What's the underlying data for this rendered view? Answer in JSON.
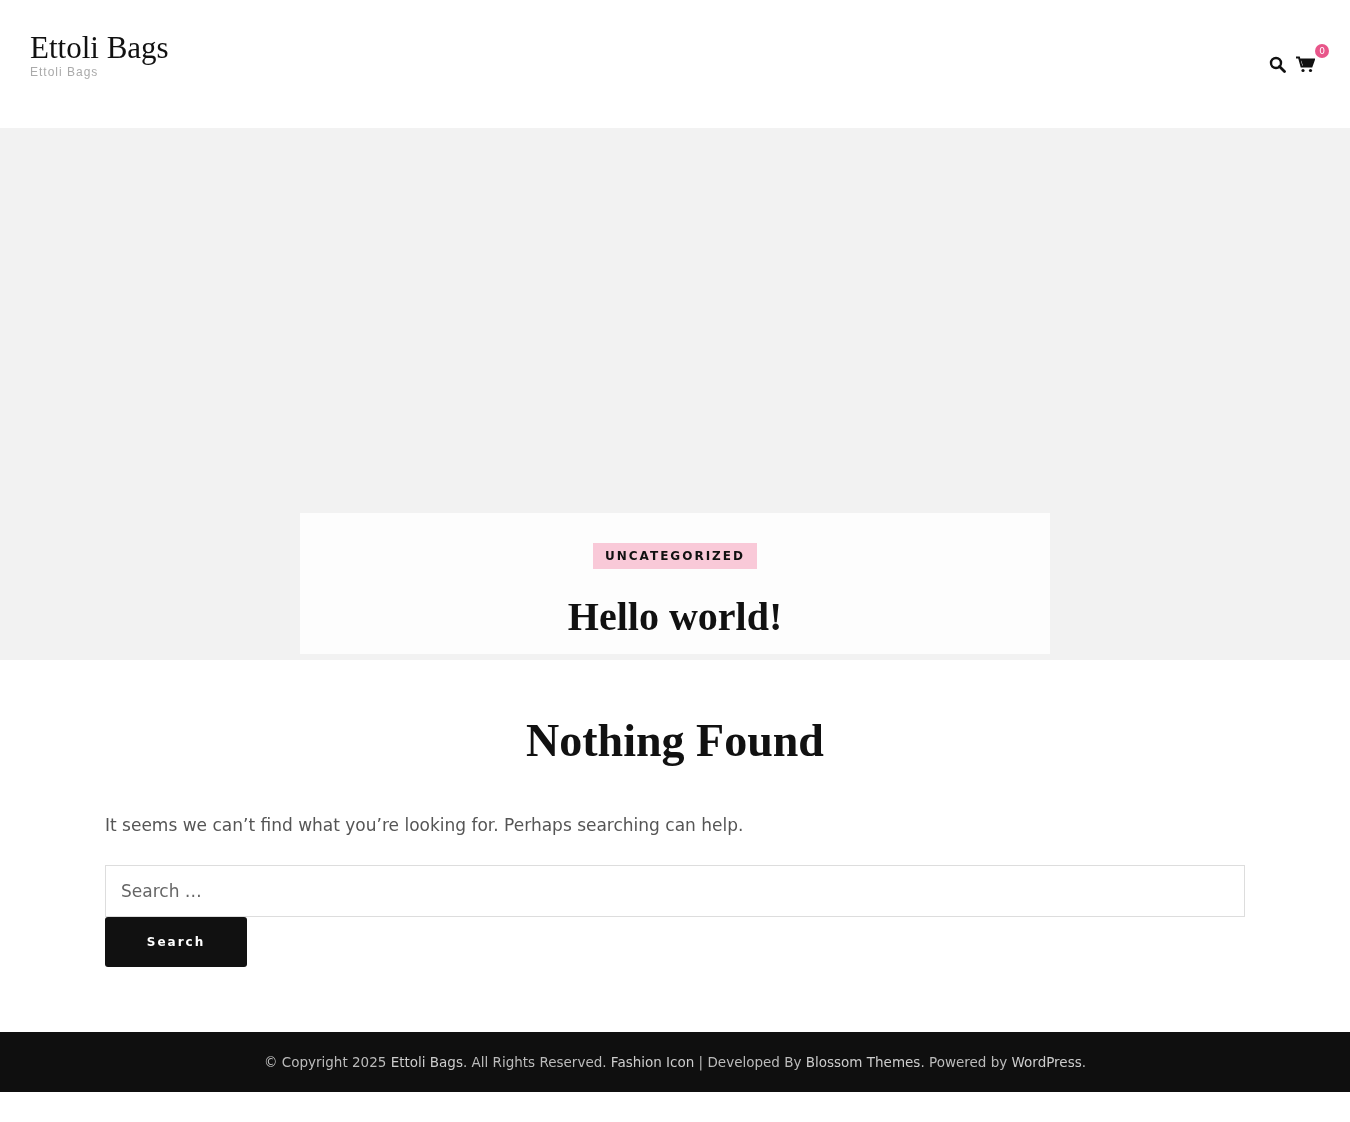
{
  "header": {
    "site_title": "Ettoli Bags",
    "tagline": "Ettoli Bags",
    "cart_count": "0"
  },
  "post": {
    "category": "UNCATEGORIZED",
    "title": "Hello world!"
  },
  "content": {
    "heading": "Nothing Found",
    "message": "It seems we can’t find what you’re looking for. Perhaps searching can help.",
    "search": {
      "placeholder": "Search …"
    },
    "button": "Search"
  },
  "footer": {
    "parts": [
      {
        "kind": "text",
        "text": "© Copyright 2025 "
      },
      {
        "kind": "link",
        "text": "Ettoli Bags"
      },
      {
        "kind": "text",
        "text": ". All Rights Reserved. "
      },
      {
        "kind": "link",
        "text": "Fashion Icon"
      },
      {
        "kind": "text",
        "text": " | Developed By "
      },
      {
        "kind": "link",
        "text": "Blossom Themes"
      },
      {
        "kind": "text",
        "text": ". Powered by "
      },
      {
        "kind": "link",
        "text": "WordPress"
      },
      {
        "kind": "text",
        "text": "."
      }
    ]
  }
}
